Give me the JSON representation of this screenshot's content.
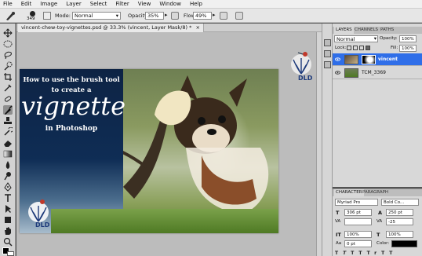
{
  "menu": [
    "File",
    "Edit",
    "Image",
    "Layer",
    "Select",
    "Filter",
    "View",
    "Window",
    "Help"
  ],
  "options": {
    "brush_size": "349",
    "mode_label": "Mode:",
    "mode_value": "Normal",
    "opacity_label": "Opacity:",
    "opacity_value": "35%",
    "flow_label": "Flow:",
    "flow_value": "49%"
  },
  "document": {
    "tab_title": "vincent-chew-toy-vignettes.psd @ 33.3% (vincent, Layer Mask/8) *",
    "headline_line1": "How to use the brush tool",
    "headline_line2": "to create a",
    "headline_big": "vignette",
    "headline_line3": "in Photoshop",
    "logo_text": "DLD"
  },
  "layers_panel": {
    "tabs": [
      "LAYERS",
      "CHANNELS",
      "PATHS"
    ],
    "blend_mode": "Normal",
    "opacity_label": "Opacity:",
    "opacity_value": "100%",
    "lock_label": "Lock:",
    "fill_label": "Fill:",
    "fill_value": "100%",
    "layers": [
      {
        "name": "vincent",
        "selected": true
      },
      {
        "name": "TCM_3369",
        "selected": false
      }
    ]
  },
  "character_panel": {
    "tabs": [
      "CHARACTER",
      "PARAGRAPH"
    ],
    "font_family": "Myriad Pro",
    "font_style": "Bold Co...",
    "font_size": "306 pt",
    "leading": "250 pt",
    "kerning": "",
    "tracking": "-25",
    "vertical_scale": "100%",
    "horizontal_scale": "100%",
    "baseline_shift": "0 pt",
    "color_label": "Color:"
  },
  "colors": {
    "accent_selected_layer": "#2f6ee8",
    "menu_bg": "#f0f0f0",
    "panel_bg": "#d8d8d8",
    "navy": "#0f2d55"
  }
}
